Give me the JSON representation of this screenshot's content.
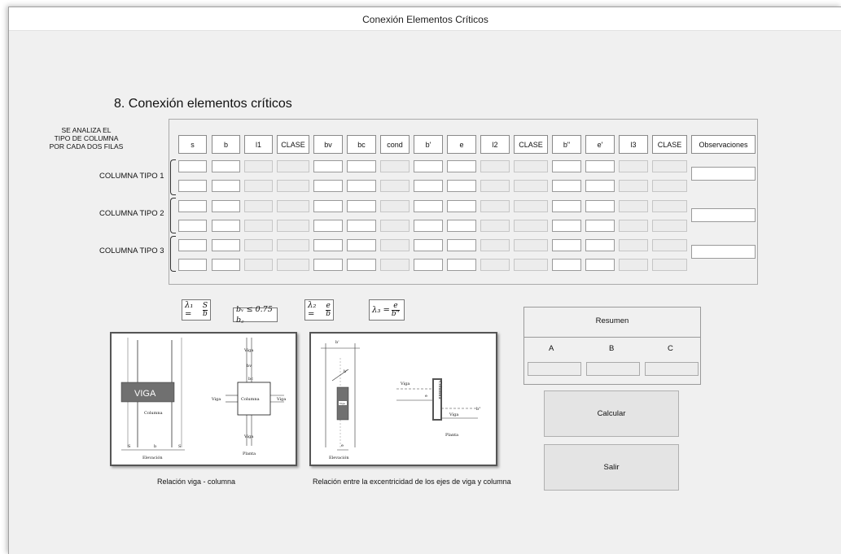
{
  "window": {
    "title": "Conexión Elementos Críticos"
  },
  "section_title": "8. Conexión elementos críticos",
  "side_note": [
    "SE ANALIZA EL",
    "TIPO DE COLUMNA",
    "POR CADA DOS FILAS"
  ],
  "columns": [
    "s",
    "b",
    "l1",
    "CLASE",
    "bv",
    "bc",
    "cond",
    "b'",
    "e",
    "l2",
    "CLASE",
    "b\"",
    "e'",
    "l3",
    "CLASE",
    "Observaciones"
  ],
  "row_labels": [
    "COLUMNA  TIPO 1",
    "COLUMNA TIPO 2",
    "COLUMNA TIPO 3"
  ],
  "formulas": {
    "f1_lhs": "λ₁ =",
    "f1_num": "S",
    "f1_den": "b",
    "f2": "bᵥ ≤ 0.75 b꜀",
    "f3_lhs": "λ₂ =",
    "f3_num": "e",
    "f3_den": "b",
    "f4_lhs": "λ₃ =",
    "f4_num": "e",
    "f4_den": "b\""
  },
  "diagram1": {
    "viga": "VIGA",
    "columna": "Columna",
    "elevacion": "Elevación",
    "s1": "S",
    "b": "b",
    "s2": "S",
    "bv": "bv",
    "bc": "bc",
    "viga_left": "Viga",
    "viga_right": "Viga",
    "viga_top": "Viga",
    "viga_bottom": "Viga",
    "columna_plan": "Columna",
    "planta": "Planta",
    "caption": "Relación viga - columna"
  },
  "diagram2": {
    "b_prime_top": "b'",
    "b_prime": "b'",
    "viga_small": "Viga",
    "e": "e",
    "elevacion": "Elevación",
    "viga_plan": "Viga",
    "viga_plan2": "Viga",
    "columna": "Columna",
    "planta": "Planta",
    "e_plan": "e",
    "b_dd": "b\"",
    "caption": "Relación entre la excentricidad de los ejes de viga y columna"
  },
  "resumen": {
    "title": "Resumen",
    "cols": [
      "A",
      "B",
      "C"
    ]
  },
  "buttons": {
    "calcular": "Calcular",
    "salir": "Salir"
  },
  "colors": {
    "window_bg": "#f0f0f0",
    "disabled_cell": "#ececec",
    "viga_fill": "#707070"
  }
}
